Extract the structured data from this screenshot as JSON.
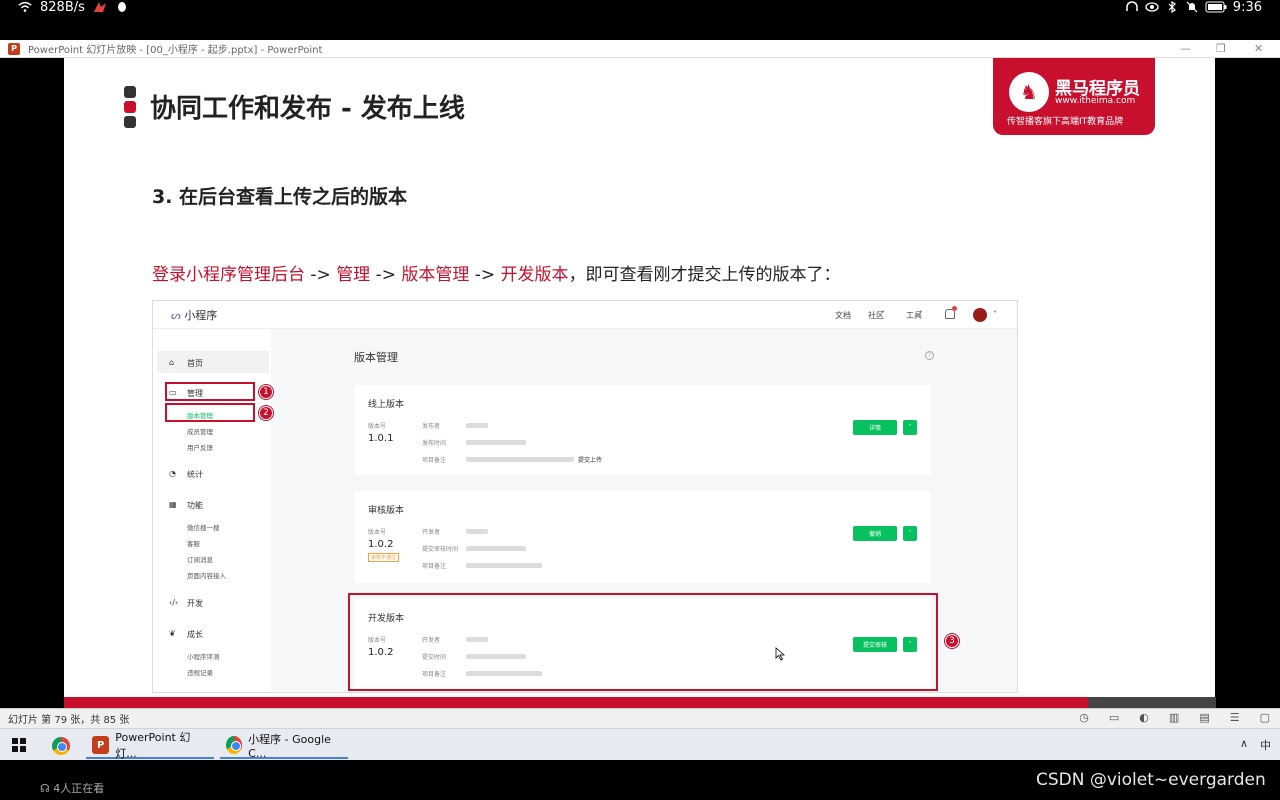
{
  "status_bar": {
    "net_speed": "828B/s",
    "time": "9:36"
  },
  "ppt_window": {
    "title": "PowerPoint 幻灯片放映 - [00_小程序 - 起步.pptx] - PowerPoint",
    "logo": "P"
  },
  "slide": {
    "title": "协同工作和发布 - 发布上线",
    "brand": {
      "name": "黑马程序员",
      "url": "www.itheima.com",
      "slogan": "传智播客旗下高端IT教育品牌"
    },
    "subtitle": "3. 在后台查看上传之后的版本",
    "instruction": {
      "p1": "登录小程序管理后台",
      "sep1": " -> ",
      "p2": "管理",
      "sep2": " -> ",
      "p3": "版本管理",
      "sep3": " -> ",
      "p4": "开发版本",
      "rest": "，即可查看刚才提交上传的版本了："
    },
    "screenshot": {
      "app_name": "小程序",
      "header_links": [
        "文档",
        "社区",
        "工具"
      ],
      "sidebar": {
        "home": "首页",
        "manage": "管理",
        "manage_items": [
          "版本管理",
          "成员管理",
          "用户反馈"
        ],
        "stats": "统计",
        "features": "功能",
        "feature_items": [
          "微信搜一搜",
          "客服",
          "订阅消息",
          "页面内容接入"
        ],
        "dev": "开发",
        "growth": "成长",
        "growth_items": [
          "小程序评测",
          "违规记录"
        ]
      },
      "page_title": "版本管理",
      "cards": {
        "online": {
          "title": "线上版本",
          "ver_label": "版本号",
          "version": "1.0.1",
          "fields": [
            "发布者",
            "发布时间",
            "项目备注"
          ],
          "note_tail": "提交上传",
          "button": "详情"
        },
        "review": {
          "title": "审核版本",
          "ver_label": "版本号",
          "version": "1.0.2",
          "tag": "审核不通过",
          "fields": [
            "开发者",
            "提交审核时间",
            "项目备注"
          ],
          "button": "撤销"
        },
        "dev": {
          "title": "开发版本",
          "ver_label": "版本号",
          "version": "1.0.2",
          "fields": [
            "开发者",
            "提交时间",
            "项目备注"
          ],
          "button": "提交审核"
        }
      },
      "badges": [
        "1",
        "2",
        "3"
      ]
    }
  },
  "ppt_status": {
    "slide_info": "幻灯片 第 79 张，共 85 张"
  },
  "taskbar": {
    "items": [
      "PowerPoint 幻灯...",
      "小程序 - Google C..."
    ],
    "ime": "中"
  },
  "live": {
    "viewers": "4人正在看"
  },
  "watermark": "CSDN @violet~evergarden",
  "colors": {
    "brand_red": "#c8102e",
    "wechat_green": "#07c160"
  }
}
